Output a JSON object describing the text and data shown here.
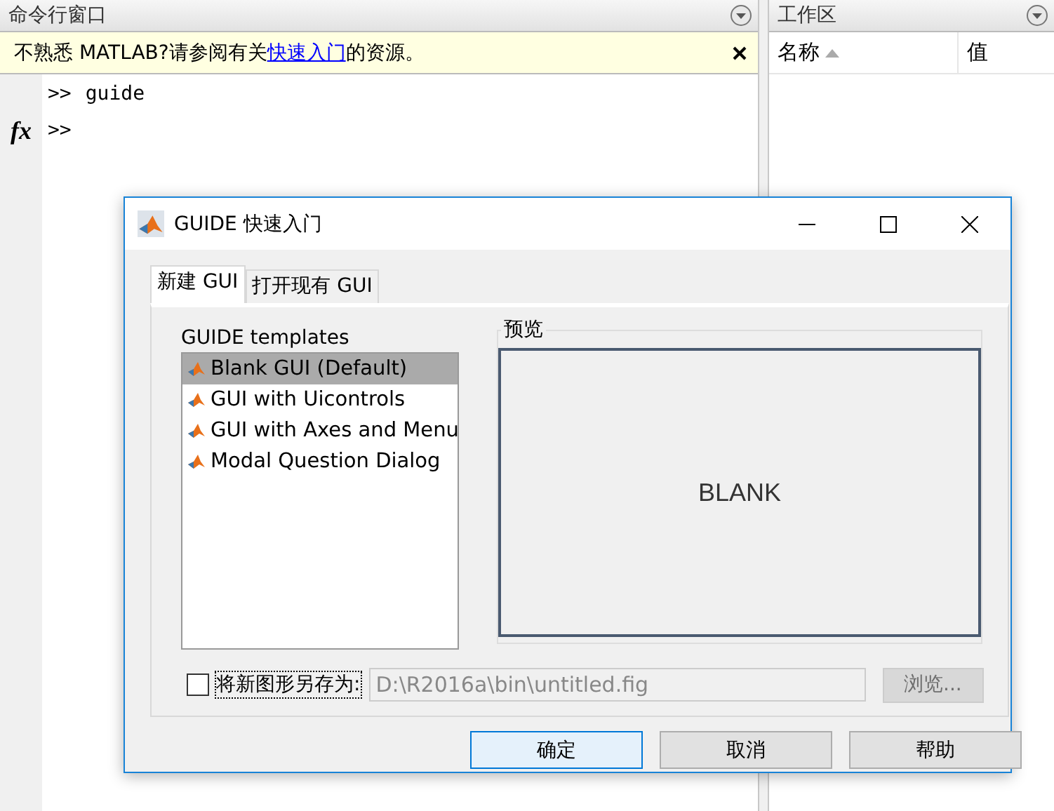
{
  "command_window": {
    "title": "命令行窗口",
    "notice": {
      "before": "不熟悉 MATLAB?请参阅有关",
      "link": "快速入门",
      "after": "的资源。"
    },
    "fx": "fx",
    "lines": [
      {
        "prompt": ">>",
        "text": "guide"
      },
      {
        "prompt": ">>"
      }
    ]
  },
  "workspace": {
    "title": "工作区",
    "columns": [
      {
        "label": "名称",
        "sorted": true
      },
      {
        "label": "值",
        "sorted": false
      }
    ]
  },
  "dialog": {
    "title": "GUIDE 快速入门",
    "tabs": [
      {
        "label": "新建 GUI",
        "selected": true
      },
      {
        "label": "打开现有 GUI",
        "selected": false
      }
    ],
    "templates_label": "GUIDE templates",
    "templates": [
      {
        "label": "Blank GUI (Default)",
        "selected": true
      },
      {
        "label": "GUI with Uicontrols",
        "selected": false
      },
      {
        "label": "GUI with Axes and Menu",
        "selected": false
      },
      {
        "label": "Modal Question Dialog",
        "selected": false
      }
    ],
    "preview_label": "预览",
    "preview_text": "BLANK",
    "save_checkbox": {
      "label": "将新图形另存为:",
      "checked": false
    },
    "path": {
      "value": "D:\\R2016a\\bin\\untitled.fig",
      "disabled": true
    },
    "browse_button": {
      "label": "浏览...",
      "disabled": true
    },
    "buttons": [
      {
        "label": "确定",
        "default": true
      },
      {
        "label": "取消",
        "default": false
      },
      {
        "label": "帮助",
        "default": false
      }
    ]
  }
}
